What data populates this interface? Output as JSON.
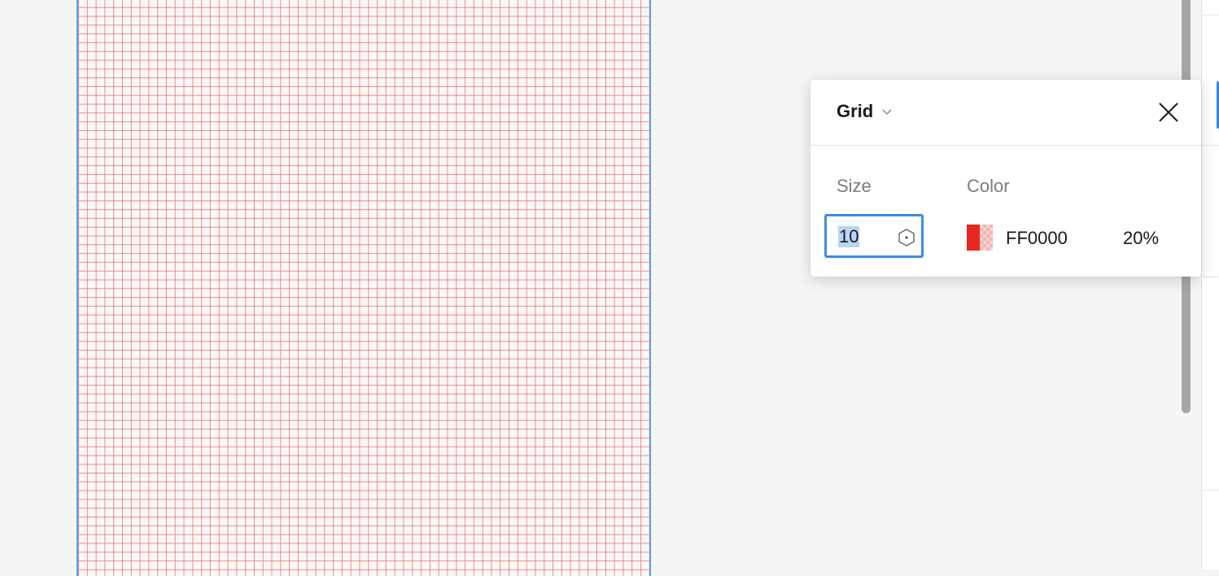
{
  "popover": {
    "title": "Grid",
    "size_label": "Size",
    "color_label": "Color",
    "size_value": "10",
    "color_hex": "FF0000",
    "opacity": "20%"
  },
  "icons": {
    "dropdown": "chevron-down-icon",
    "close": "close-icon",
    "stepper": "hexagon-icon"
  },
  "colors": {
    "grid_line": "#EC645A",
    "swatch": "#FF0000",
    "focus": "#3C8DE6",
    "frame_border": "#5B9CE8"
  }
}
